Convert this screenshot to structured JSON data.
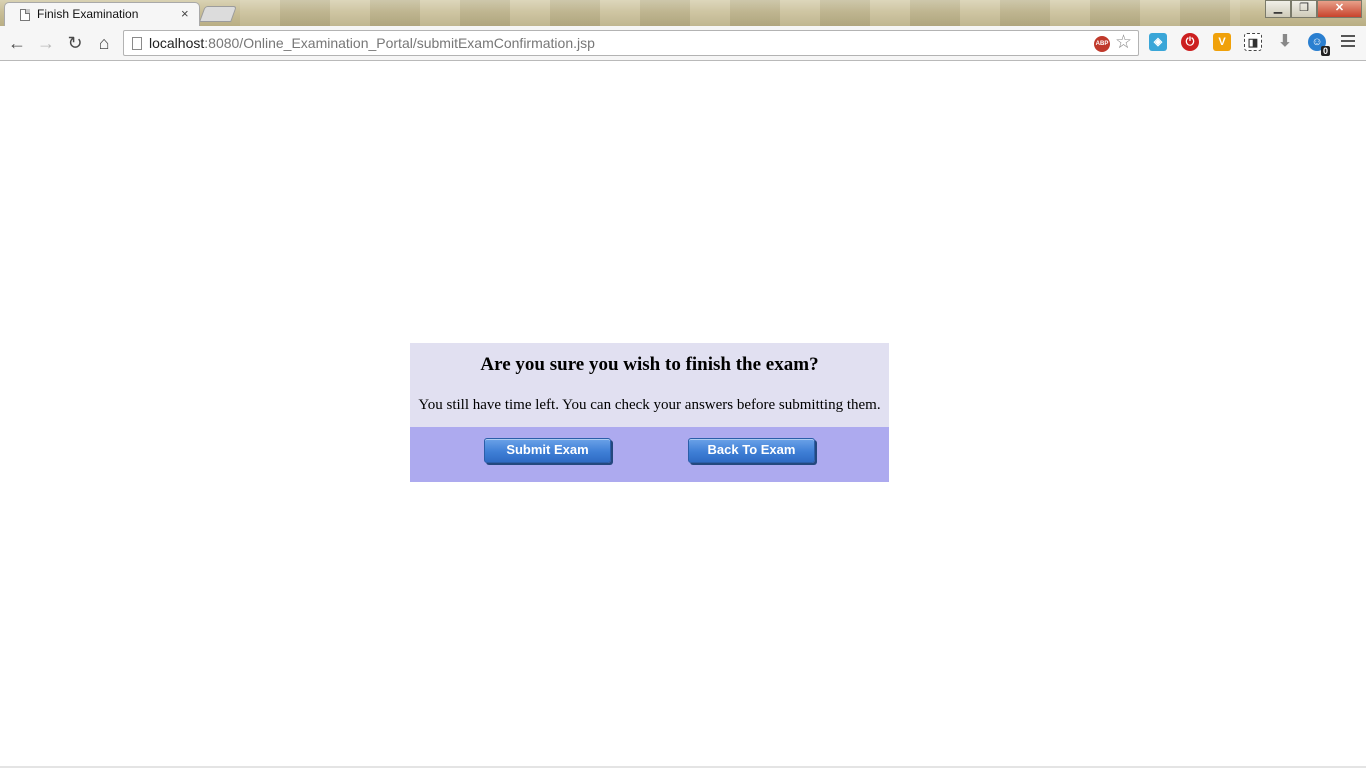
{
  "browser": {
    "tab_title": "Finish Examination",
    "tab_close": "×",
    "url_host": "localhost",
    "url_rest": ":8080/Online_Examination_Portal/submitExamConfirmation.jsp",
    "window_buttons": {
      "minimize": "▁",
      "maximize": "❐",
      "close": "✕"
    },
    "nav": {
      "back": "←",
      "forward": "→",
      "reload": "↻",
      "home": "⌂"
    },
    "abp_label": "ABP",
    "star": "☆",
    "extensions": {
      "ext1": "◈",
      "ext2": "⏻",
      "ext3": "V",
      "ext4": "◨",
      "ext5": "⬇",
      "ext6": "☺",
      "ext6_badge": "0"
    }
  },
  "confirm": {
    "heading": "Are you sure you wish to finish the exam?",
    "message": "You still have time left. You can check your answers before submitting them.",
    "submit_label": "Submit Exam",
    "back_label": "Back To Exam"
  },
  "colors": {
    "panel_top": "#e1e0f1",
    "panel_bottom": "#adaaef",
    "button": "#3f7fd6"
  }
}
